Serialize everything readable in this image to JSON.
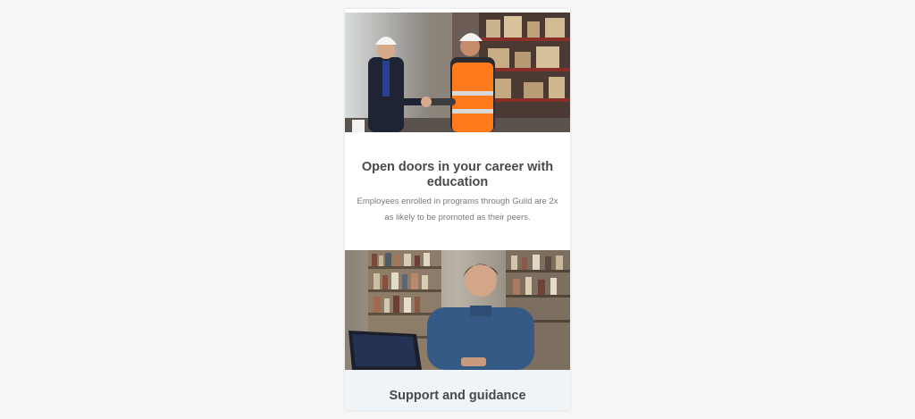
{
  "colors": {
    "page_background": "#f7f7f7",
    "card_background": "#ffffff",
    "second_card_background": "#eef4f7",
    "heading_text": "#4a4a4a",
    "body_text": "#7a7a7a",
    "safety_vest": "#ff7a1a"
  },
  "section_1": {
    "image": "warehouse-handshake-photo",
    "title": "Open doors in your career with education",
    "body": "Employees enrolled in programs through Guild are 2x as likely to be promoted as their peers."
  },
  "section_2": {
    "image": "student-with-laptop-in-library-photo",
    "title": "Support and guidance"
  }
}
